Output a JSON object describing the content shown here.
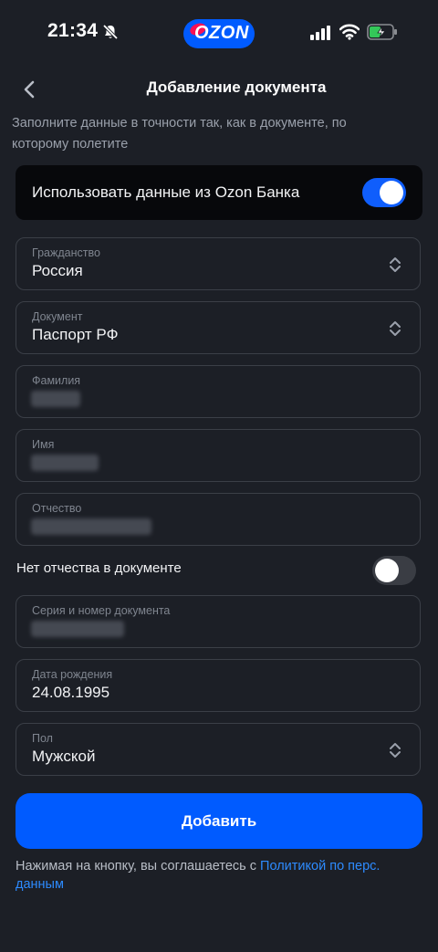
{
  "status_bar": {
    "time": "21:34"
  },
  "brand": {
    "logo_text": "OZON",
    "accent": "#005bff"
  },
  "header": {
    "title": "Добавление документа"
  },
  "hint": "Заполните данные в точности так, как в документе, по которому полетите",
  "bank_data": {
    "label": "Использовать данные из Ozon Банка",
    "enabled": true
  },
  "fields": {
    "citizenship": {
      "label": "Гражданство",
      "value": "Россия"
    },
    "document": {
      "label": "Документ",
      "value": "Паспорт РФ"
    },
    "surname": {
      "label": "Фамилия"
    },
    "name": {
      "label": "Имя"
    },
    "patronymic": {
      "label": "Отчество"
    },
    "doc_number": {
      "label": "Серия и номер документа"
    },
    "birth_date": {
      "label": "Дата рождения",
      "value": "24.08.1995"
    },
    "gender": {
      "label": "Пол",
      "value": "Мужской"
    }
  },
  "no_patronymic": {
    "label": "Нет отчества в документе",
    "enabled": false
  },
  "submit": {
    "label": "Добавить"
  },
  "consent": {
    "text": "Нажимая на кнопку, вы соглашаетесь  с ",
    "link": "Политикой по перс. данным"
  },
  "colors": {
    "background": "#1c1f26",
    "primary": "#005bff",
    "link": "#2d8bff"
  }
}
